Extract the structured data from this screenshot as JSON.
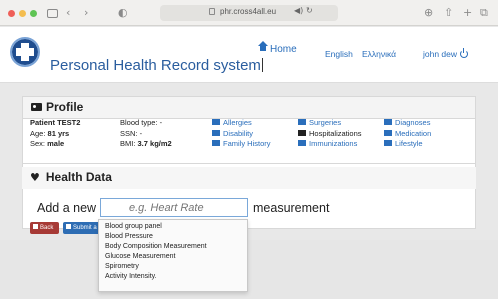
{
  "browser": {
    "url": "phr.cross4all.eu"
  },
  "header": {
    "site_title": "Personal Health Record system",
    "nav": {
      "home": "Home",
      "english": "English",
      "greek": "Ελληνικά",
      "user": "john dew"
    }
  },
  "profile": {
    "title": "Profile",
    "patient": "Patient TEST2",
    "age_label": "Age:",
    "age_value": "81 yrs",
    "sex_label": "Sex:",
    "sex_value": "male",
    "blood_type": "Blood type: -",
    "ssn": "SSN: -",
    "bmi_label": "BMI:",
    "bmi_value": "3.7 kg/m2",
    "links": [
      {
        "label": "Allergies",
        "color": "#2a6ebb"
      },
      {
        "label": "Disability",
        "color": "#2a6ebb"
      },
      {
        "label": "Family History",
        "color": "#2a6ebb"
      },
      {
        "label": "Surgeries",
        "color": "#2a6ebb"
      },
      {
        "label": "Hospitalizations",
        "color": "#222222"
      },
      {
        "label": "Immunizations",
        "color": "#2a6ebb"
      },
      {
        "label": "Diagnoses",
        "color": "#2a6ebb"
      },
      {
        "label": "Medication",
        "color": "#2a6ebb"
      },
      {
        "label": "Lifestyle",
        "color": "#2a6ebb"
      }
    ]
  },
  "health_data": {
    "title": "Health Data",
    "add_new": "Add a new",
    "input_placeholder": "e.g. Heart Rate",
    "measurement": "measurement",
    "back_button": "Back",
    "submit_button": "Submit a",
    "dropdown_options": [
      "Blood group panel",
      "Blood Pressure",
      "Body Composition Measurement",
      "Glucose Measurement",
      "Spirometry",
      "Activity Intensity."
    ]
  },
  "colors": {
    "link": "#2a6ebb",
    "back_button": "#a73a36",
    "submit_button": "#2e6db4"
  }
}
